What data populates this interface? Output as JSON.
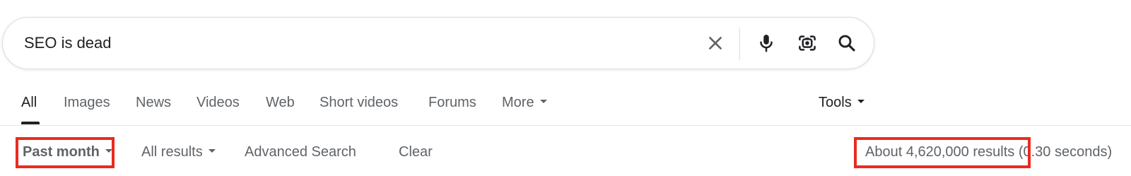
{
  "search": {
    "query": "SEO is dead",
    "icons": [
      "close-icon",
      "microphone-icon",
      "lens-camera-icon",
      "search-icon"
    ]
  },
  "tabs": {
    "items": [
      {
        "label": "All"
      },
      {
        "label": "Images"
      },
      {
        "label": "News"
      },
      {
        "label": "Videos"
      },
      {
        "label": "Web"
      },
      {
        "label": "Short videos"
      },
      {
        "label": "Forums"
      },
      {
        "label": "More"
      }
    ],
    "tools_label": "Tools"
  },
  "filters": {
    "time": "Past month",
    "results_type": "All results",
    "advanced": "Advanced Search",
    "clear": "Clear"
  },
  "stats": {
    "results": "About 4,620,000 results",
    "time": "(0.30 seconds)"
  },
  "colors": {
    "highlight": "#ea2b1f",
    "text_primary": "#202124",
    "text_secondary": "#5f6368"
  }
}
